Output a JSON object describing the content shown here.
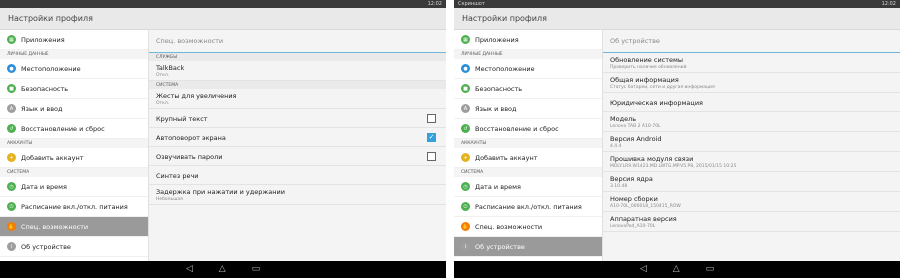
{
  "status_bar": {
    "left": {
      "left_text": "",
      "right_text": "12:02"
    },
    "right": {
      "left_text": "Скриншот",
      "right_text": "12:02"
    }
  },
  "left_panel": {
    "title": "Настройки профиля",
    "sidebar": {
      "items_top": [
        {
          "label": "Приложения",
          "icon": "apps-icon",
          "color": "#4caf50"
        }
      ],
      "header_personal": "Личные данные",
      "items_personal": [
        {
          "label": "Местоположение",
          "icon": "location-icon",
          "color": "#2a8fd8"
        },
        {
          "label": "Безопасность",
          "icon": "lock-icon",
          "color": "#4caf50"
        },
        {
          "label": "Язык и ввод",
          "icon": "language-icon",
          "color": "#9e9e9e"
        },
        {
          "label": "Восстановление и сброс",
          "icon": "restore-icon",
          "color": "#4caf50"
        }
      ],
      "header_accounts": "Аккаунты",
      "items_accounts": [
        {
          "label": "Добавить аккаунт",
          "icon": "add-account-icon",
          "color": "#e3b320"
        }
      ],
      "header_system": "Система",
      "items_system": [
        {
          "label": "Дата и время",
          "icon": "clock-icon",
          "color": "#4caf50"
        },
        {
          "label": "Расписание вкл./откл. питания",
          "icon": "power-schedule-icon",
          "color": "#4caf50"
        },
        {
          "label": "Спец. возможности",
          "icon": "accessibility-icon",
          "color": "#f57c00",
          "selected": true
        },
        {
          "label": "Об устройстве",
          "icon": "info-icon",
          "color": "#9e9e9e"
        }
      ]
    },
    "detail": {
      "header": "Спец. возможности",
      "section_services": "Службы",
      "talkback": {
        "title": "TalkBack",
        "sub": "Откл."
      },
      "section_system": "Система",
      "gestures": {
        "title": "Жесты для увеличения",
        "sub": "Откл."
      },
      "large_text": {
        "title": "Крупный текст",
        "checked": false
      },
      "auto_rotate": {
        "title": "Автоповорот экрана",
        "checked": true
      },
      "speak_passwords": {
        "title": "Озвучивать пароли",
        "checked": false
      },
      "tts": {
        "title": "Синтез речи"
      },
      "delay": {
        "title": "Задержка при нажатии и удержании",
        "sub": "Небольшая"
      }
    }
  },
  "right_panel": {
    "title": "Настройки профиля",
    "sidebar": {
      "items_top": [
        {
          "label": "Приложения",
          "icon": "apps-icon",
          "color": "#4caf50"
        }
      ],
      "header_personal": "Личные данные",
      "items_personal": [
        {
          "label": "Местоположение",
          "icon": "location-icon",
          "color": "#2a8fd8"
        },
        {
          "label": "Безопасность",
          "icon": "lock-icon",
          "color": "#4caf50"
        },
        {
          "label": "Язык и ввод",
          "icon": "language-icon",
          "color": "#9e9e9e"
        },
        {
          "label": "Восстановление и сброс",
          "icon": "restore-icon",
          "color": "#4caf50"
        }
      ],
      "header_accounts": "Аккаунты",
      "items_accounts": [
        {
          "label": "Добавить аккаунт",
          "icon": "add-account-icon",
          "color": "#e3b320"
        }
      ],
      "header_system": "Система",
      "items_system": [
        {
          "label": "Дата и время",
          "icon": "clock-icon",
          "color": "#4caf50"
        },
        {
          "label": "Расписание вкл./откл. питания",
          "icon": "power-schedule-icon",
          "color": "#4caf50"
        },
        {
          "label": "Спец. возможности",
          "icon": "accessibility-icon",
          "color": "#f57c00"
        },
        {
          "label": "Об устройстве",
          "icon": "info-icon",
          "color": "#9e9e9e",
          "selected": true
        }
      ]
    },
    "detail": {
      "header": "Об устройстве",
      "rows": [
        {
          "title": "Обновление системы",
          "sub": "Проверить наличие обновлений"
        },
        {
          "title": "Общая информация",
          "sub": "Статус батареи, сети и другая информация"
        },
        {
          "title": "Юридическая информация",
          "sub": ""
        },
        {
          "title": "Модель",
          "sub": "Lenovo TAB 2 A10-70L"
        },
        {
          "title": "Версия Android",
          "sub": "4.4.4"
        },
        {
          "title": "Прошивка модуля связи",
          "sub": "MOLY.LR9.W1423.MD.LWTG.MP.V5.P8, 2015/01/15 10:25"
        },
        {
          "title": "Версия ядра",
          "sub": "3.10.48"
        },
        {
          "title": "Номер сборки",
          "sub": "A10-70L_000018_150415_ROW"
        },
        {
          "title": "Аппаратная версия",
          "sub": "LenovoPad_A10-70L"
        }
      ]
    }
  },
  "navbar": {
    "back": "◁",
    "home": "△",
    "recents": "▭"
  }
}
